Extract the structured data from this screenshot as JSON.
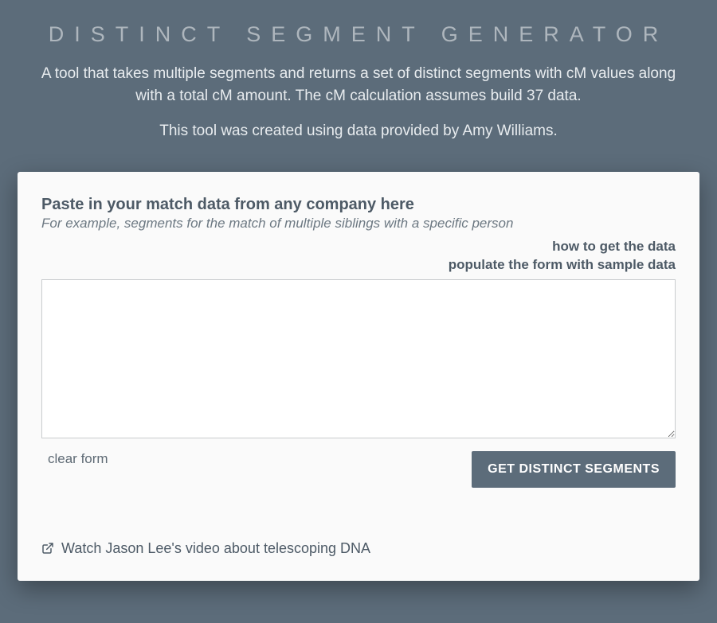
{
  "header": {
    "title": "DISTINCT SEGMENT GENERATOR",
    "description": "A tool that takes multiple segments and returns a set of distinct segments with cM values along with a total cM amount. The cM calculation assumes build 37 data.",
    "credits_prefix": "This tool was created using data provided by ",
    "credits_name": "Amy Williams",
    "credits_suffix": "."
  },
  "form": {
    "heading": "Paste in your match data from any company here",
    "subheading": "For example, segments for the match of multiple siblings with a specific person",
    "help_link": "how to get the data",
    "sample_link": "populate the form with sample data",
    "textarea_value": "",
    "clear_label": "clear form",
    "submit_label": "GET DISTINCT SEGMENTS"
  },
  "video": {
    "label": "Watch Jason Lee's video about telescoping DNA"
  }
}
